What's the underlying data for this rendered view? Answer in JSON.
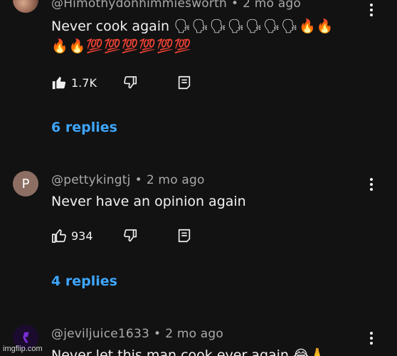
{
  "comments": [
    {
      "author": "@Himothydonhimmiesworth",
      "time": "2 mo ago",
      "text": "Never cook again",
      "emoji_line1": "🗣🗣🗣🗣🗣🗣🗣🔥🔥",
      "emoji_line2": "🔥🔥💯💯💯💯💯💯",
      "likes": "1.7K",
      "replies": "6 replies",
      "liked": true
    },
    {
      "author": "@pettykingtj",
      "avatar_letter": "P",
      "avatar_color": "#8d6e63",
      "time": "2 mo ago",
      "text": "Never have an opinion again",
      "likes": "934",
      "replies": "4 replies",
      "liked": false
    },
    {
      "author": "@jeviljuice1633",
      "time": "2 mo ago",
      "text": "Never let this man cook ever again",
      "trailing_emojis": "😂🙏"
    }
  ],
  "separator": "•",
  "colors": {
    "background": "#121212",
    "link": "#3ea6ff",
    "meta": "#aaaaaa",
    "text": "#f1f1f1"
  },
  "icons": [
    "thumbs-up-icon",
    "thumbs-down-icon",
    "reply-icon",
    "more-vert-icon"
  ],
  "watermark": "imgflip.com"
}
